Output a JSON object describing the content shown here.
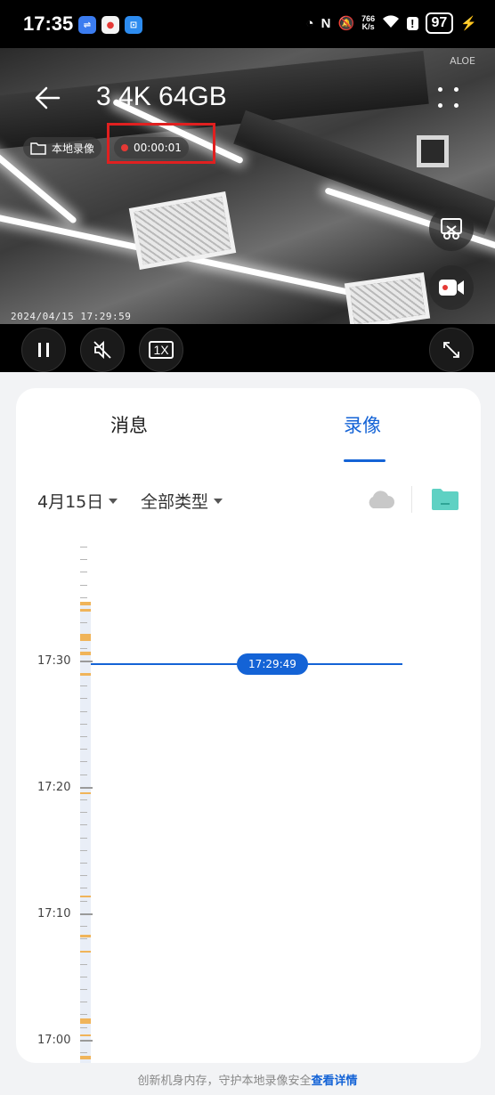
{
  "status_bar": {
    "time": "17:35",
    "net_speed_value": "766",
    "net_speed_unit": "K/s",
    "battery": "97"
  },
  "video": {
    "title": "3 4K 64GB",
    "local_record_label": "本地录像",
    "record_timer": "00:00:01",
    "timestamp": "2024/04/15  17:29:59",
    "speed_label": "1X",
    "logo_text": "ALOE"
  },
  "tabs": {
    "messages": "消息",
    "recordings": "录像"
  },
  "filters": {
    "date": "4月15日",
    "type": "全部类型"
  },
  "timeline": {
    "labels": [
      "17:30",
      "17:20",
      "17:10",
      "17:00"
    ],
    "cursor_time": "17:29:49"
  },
  "footer": {
    "text": "创新机身内存，守护本地录像安全",
    "link": "查看详情"
  },
  "colors": {
    "accent": "#1463d6",
    "record_red": "#e53935",
    "recording_segment": "#f0b45a",
    "highlight_box": "#e02020"
  }
}
